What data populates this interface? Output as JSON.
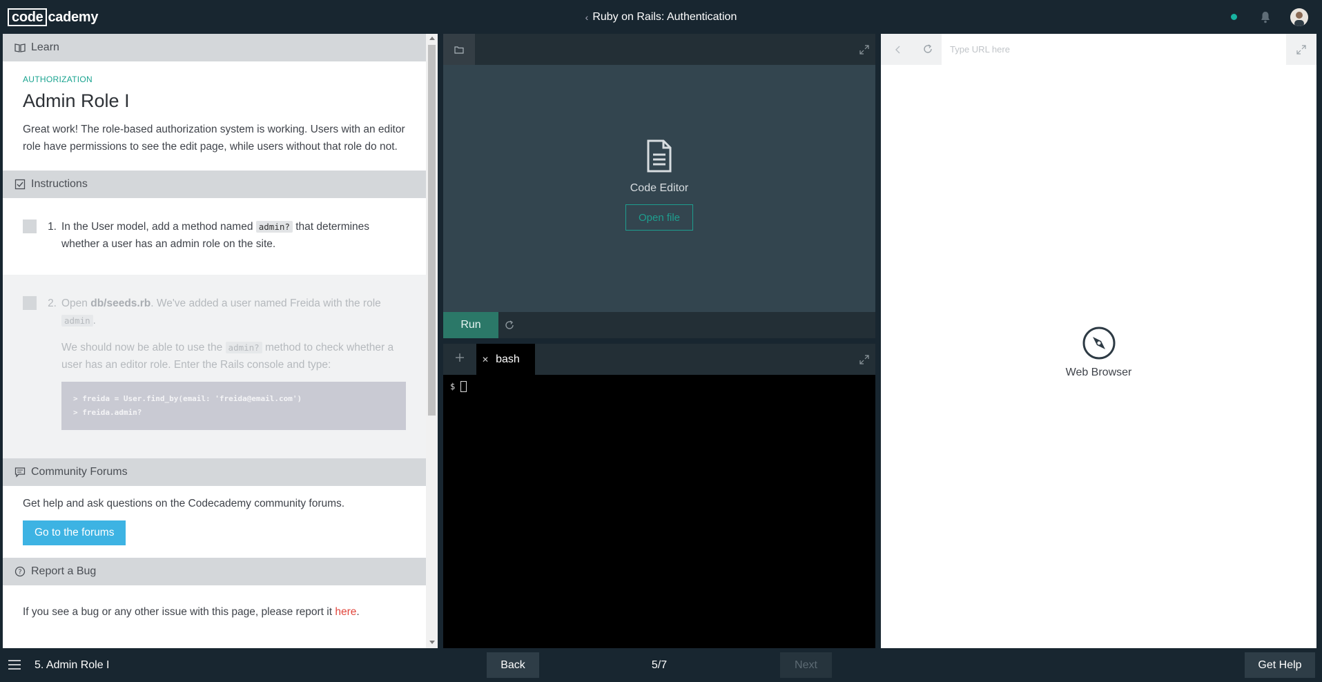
{
  "topbar": {
    "logo_boxed": "code",
    "logo_rest": "cademy",
    "course_title": "Ruby on Rails: Authentication"
  },
  "learn": {
    "header": "Learn",
    "category": "AUTHORIZATION",
    "title": "Admin Role I",
    "description": "Great work! The role-based authorization system is working. Users with an editor role have permissions to see the edit page, while users without that role do not."
  },
  "instructions": {
    "header": "Instructions",
    "task1": {
      "number": "1.",
      "text_before": "In the User model, add a method named ",
      "code": "admin?",
      "text_after": " that determines whether a user has an admin role on the site."
    },
    "task2": {
      "number": "2.",
      "p1_before": "Open ",
      "p1_file": "db/seeds.rb",
      "p1_middle": ". We've added a user named Freida with the role ",
      "p1_code": "admin",
      "p1_end": ".",
      "p2_before": "We should now be able to use the ",
      "p2_code": "admin?",
      "p2_after": " method to check whether a user has an editor role. Enter the Rails console and type:",
      "code_line1": "> freida = User.find_by(email: 'freida@email.com')",
      "code_line2": "> freida.admin?"
    }
  },
  "community": {
    "header": "Community Forums",
    "text": "Get help and ask questions on the Codecademy community forums.",
    "button": "Go to the forums"
  },
  "bug": {
    "header": "Report a Bug",
    "text_before": "If you see a bug or any other issue with this page, please report it ",
    "link": "here",
    "text_after": "."
  },
  "editor": {
    "label": "Code Editor",
    "open_file": "Open file",
    "run": "Run"
  },
  "terminal": {
    "tab": "bash",
    "prompt": "$"
  },
  "browser": {
    "url_placeholder": "Type URL here",
    "label": "Web Browser"
  },
  "bottombar": {
    "lesson": "5. Admin Role I",
    "back": "Back",
    "progress": "5/7",
    "next": "Next",
    "help": "Get Help"
  },
  "colors": {
    "accent": "#18a38f",
    "navy": "#182630",
    "forums_button": "#3db3e3",
    "link": "#e1453b"
  }
}
